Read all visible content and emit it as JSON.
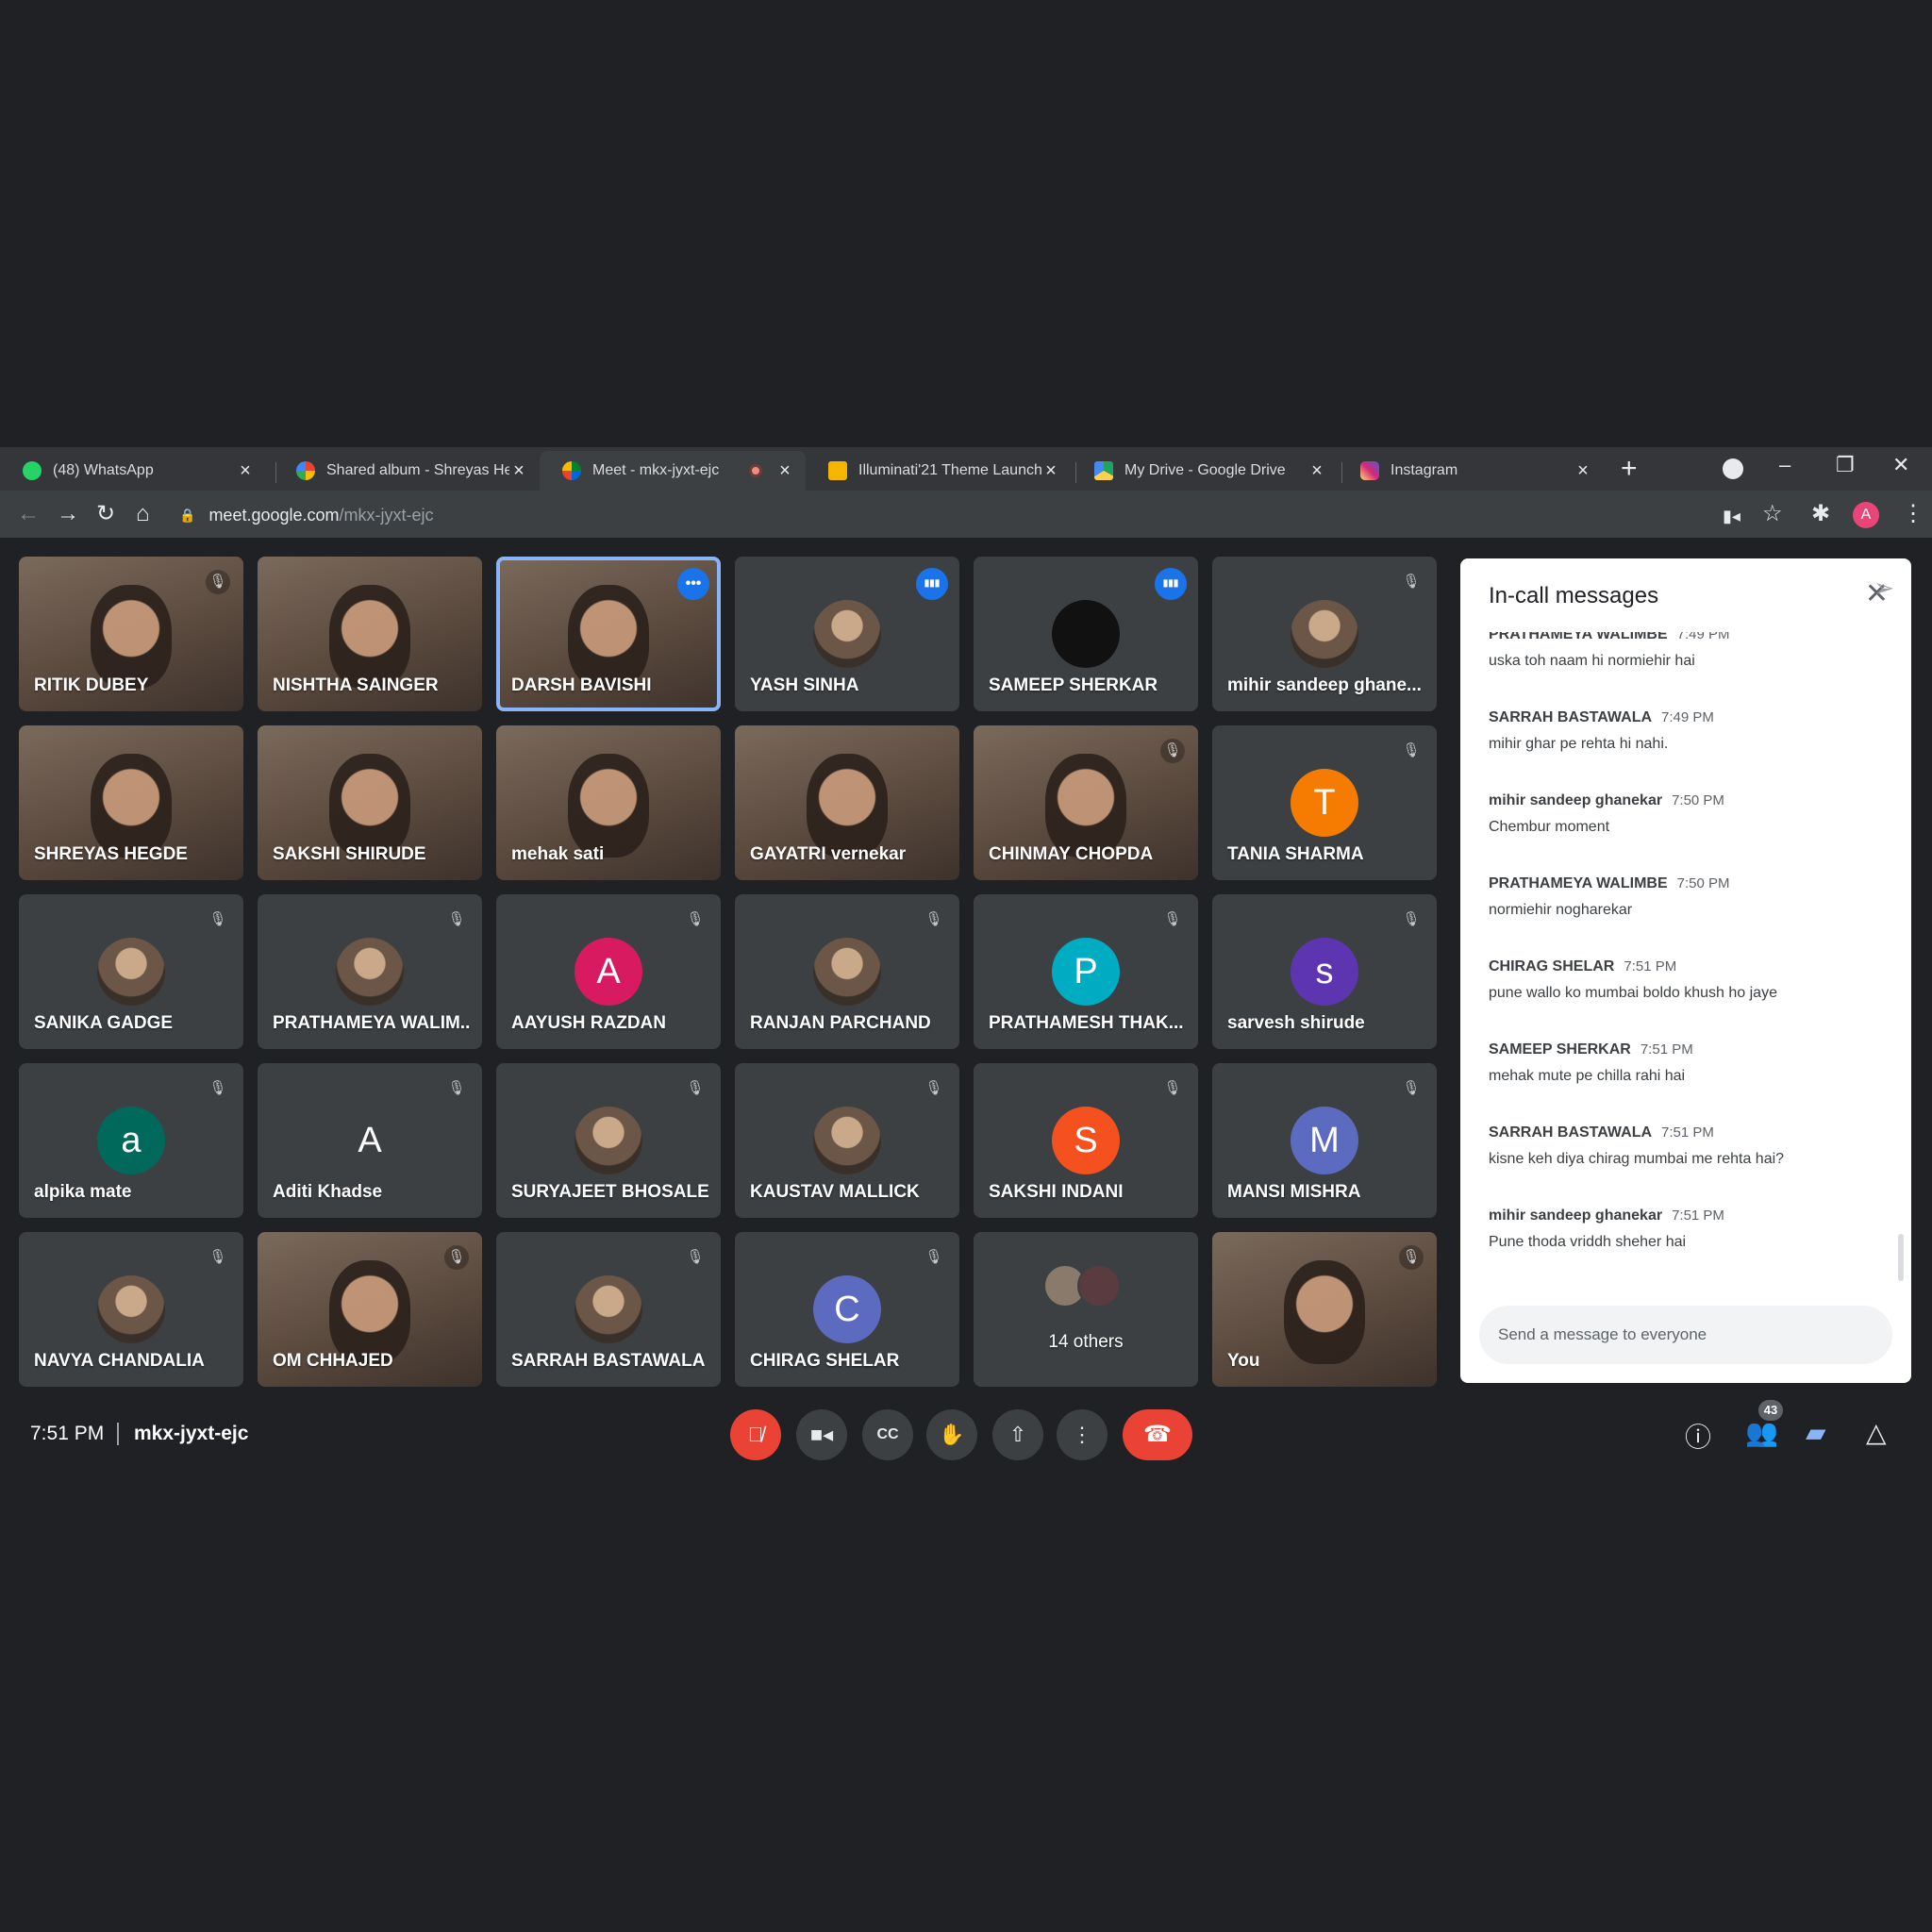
{
  "browser": {
    "tabs": [
      {
        "title": "(48) WhatsApp",
        "icon": "whatsapp-icon",
        "color": "#25d366"
      },
      {
        "title": "Shared album - Shreyas He",
        "icon": "google-photos-icon",
        "color": "#fbbc04"
      },
      {
        "title": "Meet - mkx-jyxt-ejc",
        "icon": "google-meet-icon",
        "color": "#00832d",
        "active": true,
        "recording": true
      },
      {
        "title": "Illuminati'21 Theme Launch",
        "icon": "google-slides-icon",
        "color": "#f4b400"
      },
      {
        "title": "My Drive - Google Drive",
        "icon": "google-drive-icon",
        "color": "#1fa463"
      },
      {
        "title": "Instagram",
        "icon": "instagram-icon",
        "color": "#e1306c"
      }
    ],
    "new_tab": "+",
    "url_host": "meet.google.com",
    "url_path": "/mkx-jyxt-ejc",
    "profile_initial": "A"
  },
  "participants": [
    {
      "name": "RITIK DUBEY",
      "type": "video",
      "muted": true
    },
    {
      "name": "NISHTHA SAINGER",
      "type": "video",
      "muted": false
    },
    {
      "name": "DARSH BAVISHI",
      "type": "video",
      "muted": false,
      "active": true,
      "more": true
    },
    {
      "name": "YASH SINHA",
      "type": "photo",
      "speaking": true
    },
    {
      "name": "SAMEEP SHERKAR",
      "type": "photo",
      "speaking": true,
      "avatar_color": "#111111"
    },
    {
      "name": "mihir sandeep ghane...",
      "type": "photo",
      "muted": true
    },
    {
      "name": "SHREYAS HEGDE",
      "type": "video"
    },
    {
      "name": "SAKSHI SHIRUDE",
      "type": "video"
    },
    {
      "name": "mehak sati",
      "type": "video"
    },
    {
      "name": "GAYATRI vernekar",
      "type": "video"
    },
    {
      "name": "CHINMAY CHOPDA",
      "type": "video",
      "muted": true
    },
    {
      "name": "TANIA SHARMA",
      "type": "initial",
      "initial": "T",
      "avatar_color": "#f57c00",
      "muted": true
    },
    {
      "name": "SANIKA GADGE",
      "type": "photo",
      "muted": true
    },
    {
      "name": "PRATHAMEYA WALIM...",
      "type": "photo",
      "muted": true
    },
    {
      "name": "AAYUSH RAZDAN",
      "type": "initial",
      "initial": "A",
      "avatar_color": "#d81b60",
      "muted": true
    },
    {
      "name": "RANJAN PARCHAND",
      "type": "photo",
      "muted": true
    },
    {
      "name": "PRATHAMESH THAK...",
      "type": "initial",
      "initial": "P",
      "avatar_color": "#00acc1",
      "muted": true
    },
    {
      "name": "sarvesh shirude",
      "type": "initial",
      "initial": "s",
      "avatar_color": "#5e35b1",
      "muted": true
    },
    {
      "name": "alpika mate",
      "type": "initial",
      "initial": "a",
      "avatar_color": "#00695c",
      "muted": true
    },
    {
      "name": "Aditi Khadse",
      "type": "initial",
      "initial": "A",
      "avatar_color": "#3c4043",
      "muted": true
    },
    {
      "name": "SURYAJEET BHOSALE",
      "type": "photo",
      "muted": true
    },
    {
      "name": "KAUSTAV MALLICK",
      "type": "photo",
      "muted": true
    },
    {
      "name": "SAKSHI INDANI",
      "type": "initial",
      "initial": "S",
      "avatar_color": "#f4511e",
      "muted": true
    },
    {
      "name": "MANSI MISHRA",
      "type": "initial",
      "initial": "M",
      "avatar_color": "#5c6bc0",
      "muted": true
    },
    {
      "name": "NAVYA CHANDALIA",
      "type": "photo",
      "muted": true
    },
    {
      "name": "OM CHHAJED",
      "type": "video",
      "muted": true
    },
    {
      "name": "SARRAH BASTAWALA",
      "type": "photo",
      "muted": true
    },
    {
      "name": "CHIRAG SHELAR",
      "type": "initial",
      "initial": "C",
      "avatar_color": "#5c6bc0",
      "muted": true
    },
    {
      "name": "14 others",
      "type": "others"
    },
    {
      "name": "You",
      "type": "video",
      "muted": true
    }
  ],
  "chat": {
    "title": "In-call messages",
    "messages": [
      {
        "sender": "PRATHAMEYA WALIMBE",
        "time": "7:49 PM",
        "text": "uska toh naam hi normiehir hai"
      },
      {
        "sender": "SARRAH BASTAWALA",
        "time": "7:49 PM",
        "text": "mihir ghar pe rehta hi nahi."
      },
      {
        "sender": "mihir sandeep ghanekar",
        "time": "7:50 PM",
        "text": "Chembur moment"
      },
      {
        "sender": "PRATHAMEYA WALIMBE",
        "time": "7:50 PM",
        "text": "normiehir nogharekar"
      },
      {
        "sender": "CHIRAG SHELAR",
        "time": "7:51 PM",
        "text": "pune wallo ko mumbai boldo khush ho jaye"
      },
      {
        "sender": "SAMEEP SHERKAR",
        "time": "7:51 PM",
        "text": "mehak mute pe chilla rahi hai"
      },
      {
        "sender": "SARRAH BASTAWALA",
        "time": "7:51 PM",
        "text": "kisne keh diya chirag mumbai me rehta hai?"
      },
      {
        "sender": "mihir sandeep ghanekar",
        "time": "7:51 PM",
        "text": "Pune thoda vriddh sheher hai"
      }
    ],
    "input_placeholder": "Send a message to everyone"
  },
  "bottom_bar": {
    "time": "7:51 PM",
    "meeting_code": "mkx-jyxt-ejc",
    "people_count": "43"
  },
  "colors": {
    "accent": "#1a73e8",
    "danger": "#ea4335",
    "background": "#202124",
    "tile": "#3c4043"
  }
}
